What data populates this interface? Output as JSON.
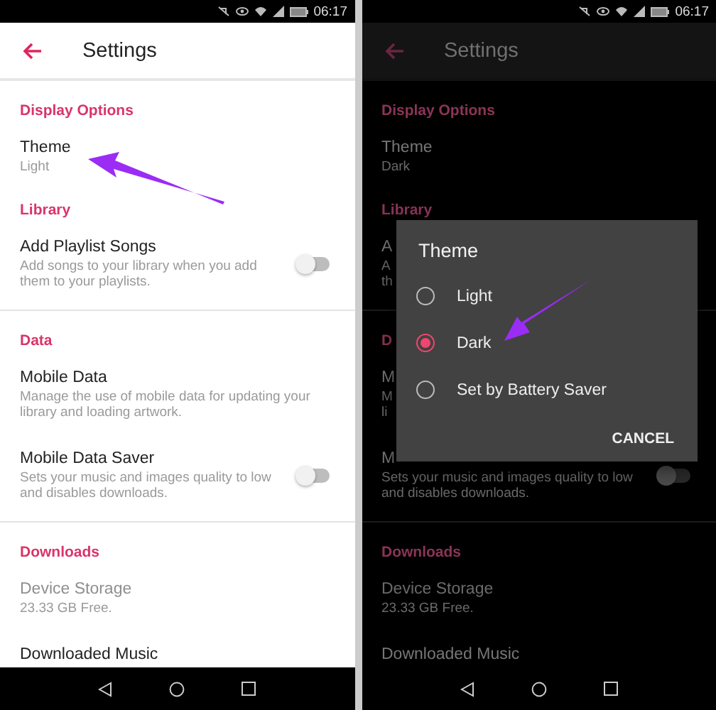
{
  "screens": [
    {
      "kind": "light",
      "status_time": "06:17",
      "title": "Settings",
      "groups": [
        {
          "sections": [
            {
              "header": "Display Options",
              "items": [
                {
                  "kind": "setting",
                  "title": "Theme",
                  "subtitle": "Light"
                }
              ]
            },
            {
              "header": "Library",
              "items": [
                {
                  "kind": "toggle",
                  "title": "Add Playlist Songs",
                  "subtitle": "Add songs to your library when you add\nthem to your playlists.",
                  "on": false
                }
              ]
            }
          ]
        },
        {
          "sections": [
            {
              "header": "Data",
              "items": [
                {
                  "kind": "setting",
                  "title": "Mobile Data",
                  "subtitle": "Manage the use of mobile data for updating your\nlibrary and loading artwork."
                },
                {
                  "kind": "toggle",
                  "title": "Mobile Data Saver",
                  "subtitle": "Sets your music and images quality to low\nand disables downloads.",
                  "on": false
                }
              ]
            }
          ]
        },
        {
          "sections": [
            {
              "header": "Downloads",
              "items": [
                {
                  "kind": "muted",
                  "title": "Device Storage",
                  "subtitle": "23.33 GB Free."
                },
                {
                  "kind": "setting",
                  "title": "Downloaded Music"
                }
              ]
            }
          ]
        }
      ]
    },
    {
      "kind": "dark",
      "status_time": "06:17",
      "title": "Settings",
      "groups": [
        {
          "sections": [
            {
              "header": "Display Options",
              "items": [
                {
                  "kind": "setting",
                  "title": "Theme",
                  "subtitle": "Dark"
                }
              ]
            },
            {
              "header": "Library",
              "items": [
                {
                  "kind": "setting",
                  "title": "A",
                  "subtitle": "A\nth"
                }
              ]
            }
          ]
        },
        {
          "sections": [
            {
              "header": "D",
              "items": [
                {
                  "kind": "setting",
                  "title": "M",
                  "subtitle": "M\nli"
                },
                {
                  "kind": "toggle",
                  "title": "M",
                  "subtitle": "Sets your music and images quality to low\nand disables downloads.",
                  "on": false
                }
              ]
            }
          ]
        },
        {
          "sections": [
            {
              "header": "Downloads",
              "items": [
                {
                  "kind": "muted",
                  "title": "Device Storage",
                  "subtitle": "23.33 GB Free."
                },
                {
                  "kind": "setting",
                  "title": "Downloaded Music"
                }
              ]
            }
          ]
        }
      ],
      "dialog": {
        "title": "Theme",
        "options": [
          {
            "label": "Light",
            "selected": false
          },
          {
            "label": "Dark",
            "selected": true
          },
          {
            "label": "Set by Battery Saver",
            "selected": false
          }
        ],
        "button": "CANCEL"
      }
    }
  ]
}
